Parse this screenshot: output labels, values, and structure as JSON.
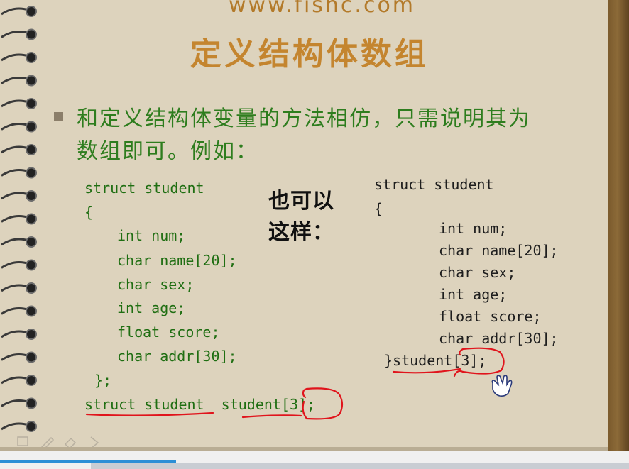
{
  "slide": {
    "site_url": "www.fishc.com",
    "title": "定义结构体数组",
    "bullet_lines": [
      "和定义结构体变量的方法相仿，只需说明其为",
      "数组即可。例如："
    ],
    "handwritten_lines": [
      "也可以",
      "这样："
    ]
  },
  "code_left": {
    "lines": [
      "struct student",
      "{",
      "int num;",
      "char name[20];",
      "char sex;",
      "int age;",
      "float score;",
      "char addr[30];",
      "};",
      "struct student  student[3];"
    ]
  },
  "code_right": {
    "lines": [
      "struct student",
      "{",
      "int num;",
      "char name[20];",
      "char sex;",
      "int age;",
      "float score;",
      "char addr[30];",
      "}student[3];"
    ]
  },
  "toolbar": {
    "icons": [
      "pointer-icon",
      "pen-icon",
      "eraser-icon",
      "menu-arrow-icon"
    ]
  },
  "playback": {
    "progress_fraction": 0.28
  },
  "colors": {
    "title": "#c4852f",
    "bullet_text": "#2e7d1e",
    "code_green": "#1f6e12",
    "annotation_red": "#e0141c"
  }
}
